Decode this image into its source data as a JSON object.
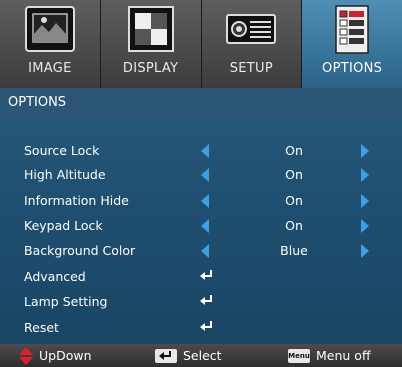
{
  "tabs": [
    {
      "label": "IMAGE",
      "icon": "image-tab-icon",
      "active": false
    },
    {
      "label": "DISPLAY",
      "icon": "display-tab-icon",
      "active": false
    },
    {
      "label": "SETUP",
      "icon": "setup-tab-icon",
      "active": false
    },
    {
      "label": "OPTIONS",
      "icon": "options-tab-icon",
      "active": true
    }
  ],
  "section": {
    "title": "OPTIONS"
  },
  "menu": {
    "items": [
      {
        "label": "Source Lock",
        "value": "On",
        "type": "selector"
      },
      {
        "label": "High Altitude",
        "value": "On",
        "type": "selector"
      },
      {
        "label": "Information Hide",
        "value": "On",
        "type": "selector"
      },
      {
        "label": "Keypad Lock",
        "value": "On",
        "type": "selector"
      },
      {
        "label": "Background Color",
        "value": "Blue",
        "type": "selector"
      },
      {
        "label": "Advanced",
        "type": "submenu"
      },
      {
        "label": "Lamp Setting",
        "type": "submenu"
      },
      {
        "label": "Reset",
        "type": "submenu"
      }
    ]
  },
  "footer": {
    "updown_label": "UpDown",
    "select_label": "Select",
    "menu_key_label": "Menu",
    "menuoff_label": "Menu off"
  },
  "colors": {
    "accent_arrow": "#3aa0e8",
    "active_tab": "#3a78a0",
    "menu_background": "#1f4f70",
    "updown_icon": "#e0202a"
  }
}
